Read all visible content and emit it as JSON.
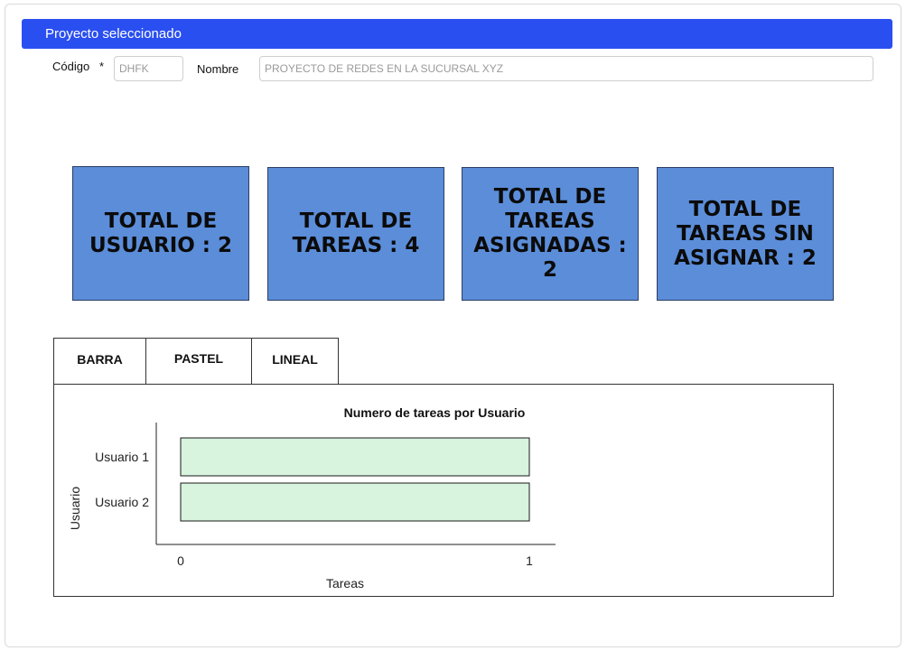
{
  "header": {
    "title": "Proyecto seleccionado"
  },
  "form": {
    "code_label": "Código",
    "required_mark": "*",
    "code_value": "DHFK",
    "name_label": "Nombre",
    "name_value": "PROYECTO DE REDES EN LA SUCURSAL XYZ"
  },
  "cards": [
    {
      "text": "TOTAL DE USUARIO : 2"
    },
    {
      "text": "TOTAL DE TAREAS : 4"
    },
    {
      "text": "TOTAL DE TAREAS ASIGNADAS : 2"
    },
    {
      "text": "TOTAL DE TAREAS SIN ASIGNAR : 2"
    }
  ],
  "tabs": [
    {
      "label": "BARRA"
    },
    {
      "label": "PASTEL"
    },
    {
      "label": "LINEAL"
    }
  ],
  "chart_data": {
    "type": "bar",
    "orientation": "horizontal",
    "title": "Numero de tareas por Usuario",
    "categories": [
      "Usuario 1",
      "Usuario 2"
    ],
    "values": [
      1,
      1
    ],
    "xlabel": "Tareas",
    "ylabel": "Usuario",
    "xlim": [
      0,
      1
    ],
    "x_ticks": [
      "0",
      "1"
    ],
    "bar_color": "#d8f3de",
    "bar_edge_color": "#1a1a1a",
    "grid": false
  },
  "colors": {
    "header": "#2a4ff0",
    "card": "#5b8dd9"
  }
}
